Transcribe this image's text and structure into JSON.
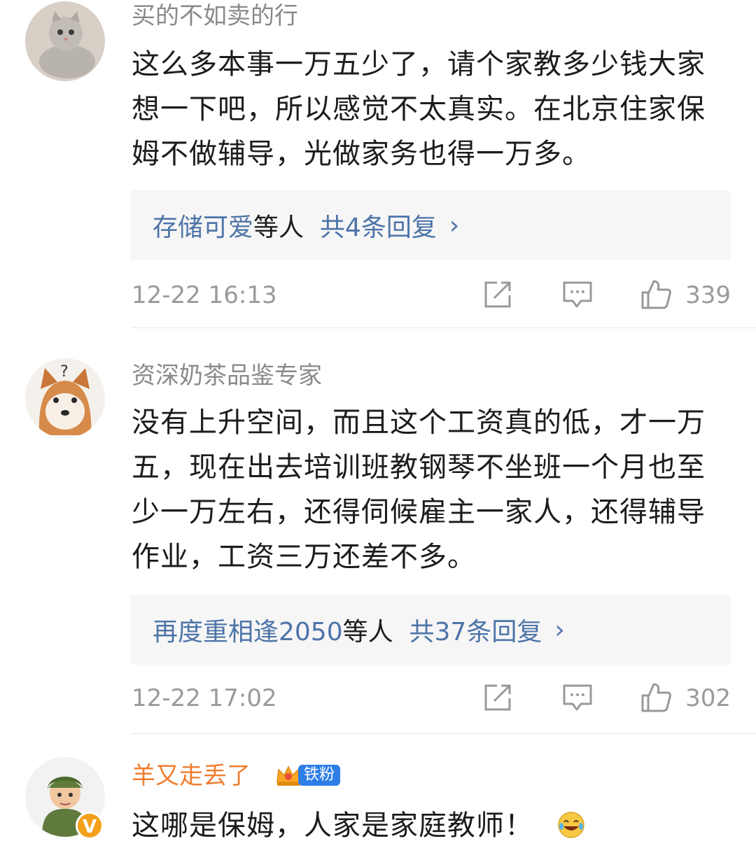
{
  "comments": [
    {
      "username": "买的不如卖的行",
      "text": "这么多本事一万五少了，请个家教多少钱大家想一下吧，所以感觉不太真实。在北京住家保姆不做辅导，光做家务也得一万多。",
      "reply_users": "存储可爱",
      "reply_mid": "等人",
      "reply_count": "共4条回复",
      "time": "12-22 16:13",
      "likes": "339"
    },
    {
      "username": "资深奶茶品鉴专家",
      "text": "没有上升空间，而且这个工资真的低，才一万五，现在出去培训班教钢琴不坐班一个月也至少一万左右，还得伺候雇主一家人，还得辅导作业，工资三万还差不多。",
      "reply_users": "再度重相逢2050",
      "reply_mid": "等人",
      "reply_count": "共37条回复",
      "time": "12-22 17:02",
      "likes": "302"
    },
    {
      "username": "羊又走丢了",
      "badge_label": "铁粉",
      "verified_mark": "V",
      "text": "这哪是保姆，人家是家庭教师！"
    }
  ],
  "icons": {
    "share": "share-icon",
    "comment": "comment-icon",
    "like": "thumbs-up-icon",
    "chevron": "chevron-right-icon",
    "emoji": "laughing-crying-emoji-icon"
  },
  "colors": {
    "username_gray": "#8a8a8a",
    "username_orange": "#f07d2e",
    "link_blue": "#4d74a8",
    "badge_blue": "#2f7ee8"
  }
}
